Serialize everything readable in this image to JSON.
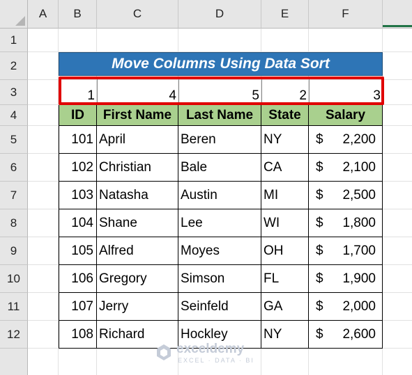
{
  "columns": [
    "A",
    "B",
    "C",
    "D",
    "E",
    "F"
  ],
  "rows": [
    "1",
    "2",
    "3",
    "4",
    "5",
    "6",
    "7",
    "8",
    "9",
    "10",
    "11",
    "12"
  ],
  "title": "Move Columns Using Data Sort",
  "sort_order": [
    "1",
    "4",
    "5",
    "2",
    "3"
  ],
  "headers": [
    "ID",
    "First Name",
    "Last Name",
    "State",
    "Salary"
  ],
  "records": [
    {
      "id": "101",
      "first": "April",
      "last": "Beren",
      "state": "NY",
      "currency": "$",
      "salary": "2,200"
    },
    {
      "id": "102",
      "first": "Christian",
      "last": "Bale",
      "state": "CA",
      "currency": "$",
      "salary": "2,100"
    },
    {
      "id": "103",
      "first": "Natasha",
      "last": "Austin",
      "state": "MI",
      "currency": "$",
      "salary": "2,500"
    },
    {
      "id": "104",
      "first": "Shane",
      "last": "Lee",
      "state": "WI",
      "currency": "$",
      "salary": "1,800"
    },
    {
      "id": "105",
      "first": "Alfred",
      "last": "Moyes",
      "state": "OH",
      "currency": "$",
      "salary": "1,700"
    },
    {
      "id": "106",
      "first": "Gregory",
      "last": "Simson",
      "state": "FL",
      "currency": "$",
      "salary": "1,900"
    },
    {
      "id": "107",
      "first": "Jerry",
      "last": "Seinfeld",
      "state": "GA",
      "currency": "$",
      "salary": "2,000"
    },
    {
      "id": "108",
      "first": "Richard",
      "last": "Hockley",
      "state": "NY",
      "currency": "$",
      "salary": "2,600"
    }
  ],
  "watermark": {
    "name": "exceldemy",
    "tagline": "EXCEL · DATA · BI"
  },
  "colors": {
    "title_fill": "#2e75b6",
    "header_fill": "#a9d08e",
    "highlight": "#e00000",
    "green_corner": "#217346"
  }
}
